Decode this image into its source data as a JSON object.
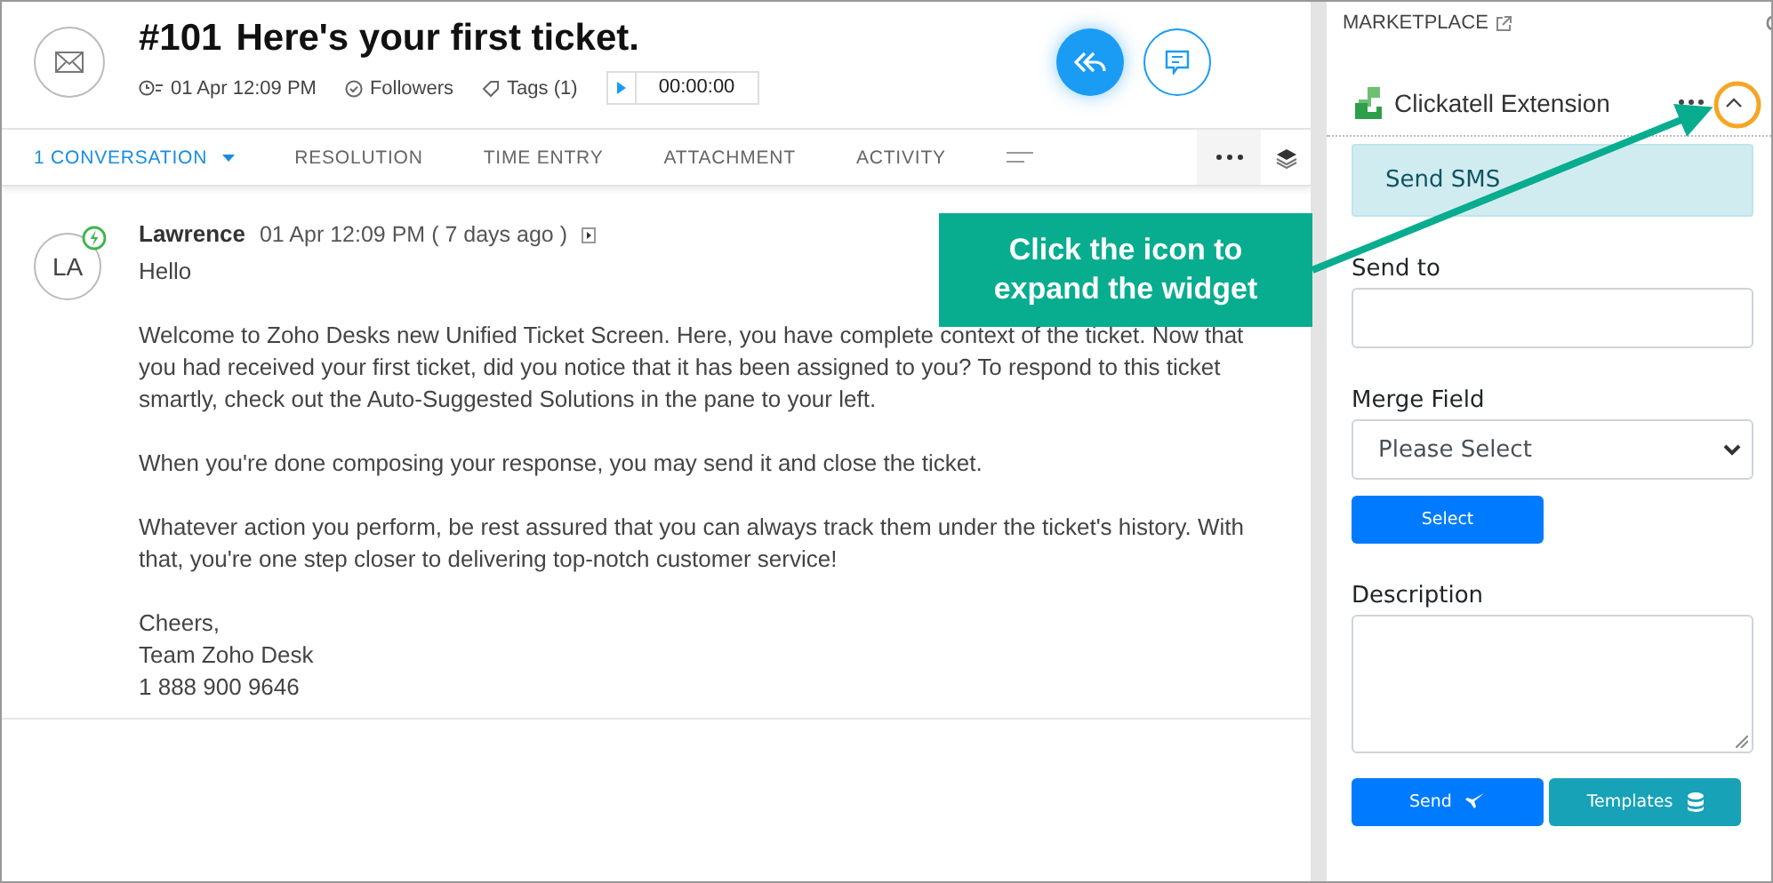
{
  "ticket": {
    "number": "#101",
    "title": "Here's your first ticket.",
    "created": "01 Apr 12:09 PM",
    "followers": "Followers",
    "tags": "Tags (1)",
    "timer": "00:00:00"
  },
  "tabs": [
    {
      "label": "1 CONVERSATION",
      "selected": true
    },
    {
      "label": "RESOLUTION",
      "selected": false
    },
    {
      "label": "TIME ENTRY",
      "selected": false
    },
    {
      "label": "ATTACHMENT",
      "selected": false
    },
    {
      "label": "ACTIVITY",
      "selected": false
    }
  ],
  "message": {
    "author": "Lawrence",
    "initials": "LA",
    "time": "01 Apr 12:09 PM ( 7 days ago )",
    "paragraphs": [
      "Hello",
      "Welcome to Zoho Desks new Unified Ticket Screen. Here, you have complete context of the ticket. Now that you had received your first ticket, did you notice that it has been assigned to you? To respond to this ticket smartly, check out the Auto-Suggested Solutions in the pane to your left.",
      "When you're done composing your response, you may send it and close the ticket.",
      "Whatever action you perform, be rest assured that you can always track them under the ticket's history. With that, you're one step closer to delivering top-notch customer service!"
    ],
    "signature": [
      "Cheers,",
      "Team Zoho Desk",
      "1 888 900 9646"
    ]
  },
  "sidebar": {
    "heading": "MARKETPLACE",
    "widget": {
      "title": "Clickatell Extension",
      "expanded": true,
      "section": "Send SMS",
      "fields": [
        {
          "kind": "input",
          "label": "Send to"
        },
        {
          "kind": "select",
          "label": "Merge Field",
          "value": "Please Select",
          "button": "Select"
        },
        {
          "kind": "textarea",
          "label": "Description"
        }
      ],
      "buttons": [
        {
          "label": "Send",
          "kind": "send"
        },
        {
          "label": "Templates",
          "kind": "templates"
        }
      ]
    }
  },
  "callout": {
    "text": "Click the icon to expand the widget"
  }
}
